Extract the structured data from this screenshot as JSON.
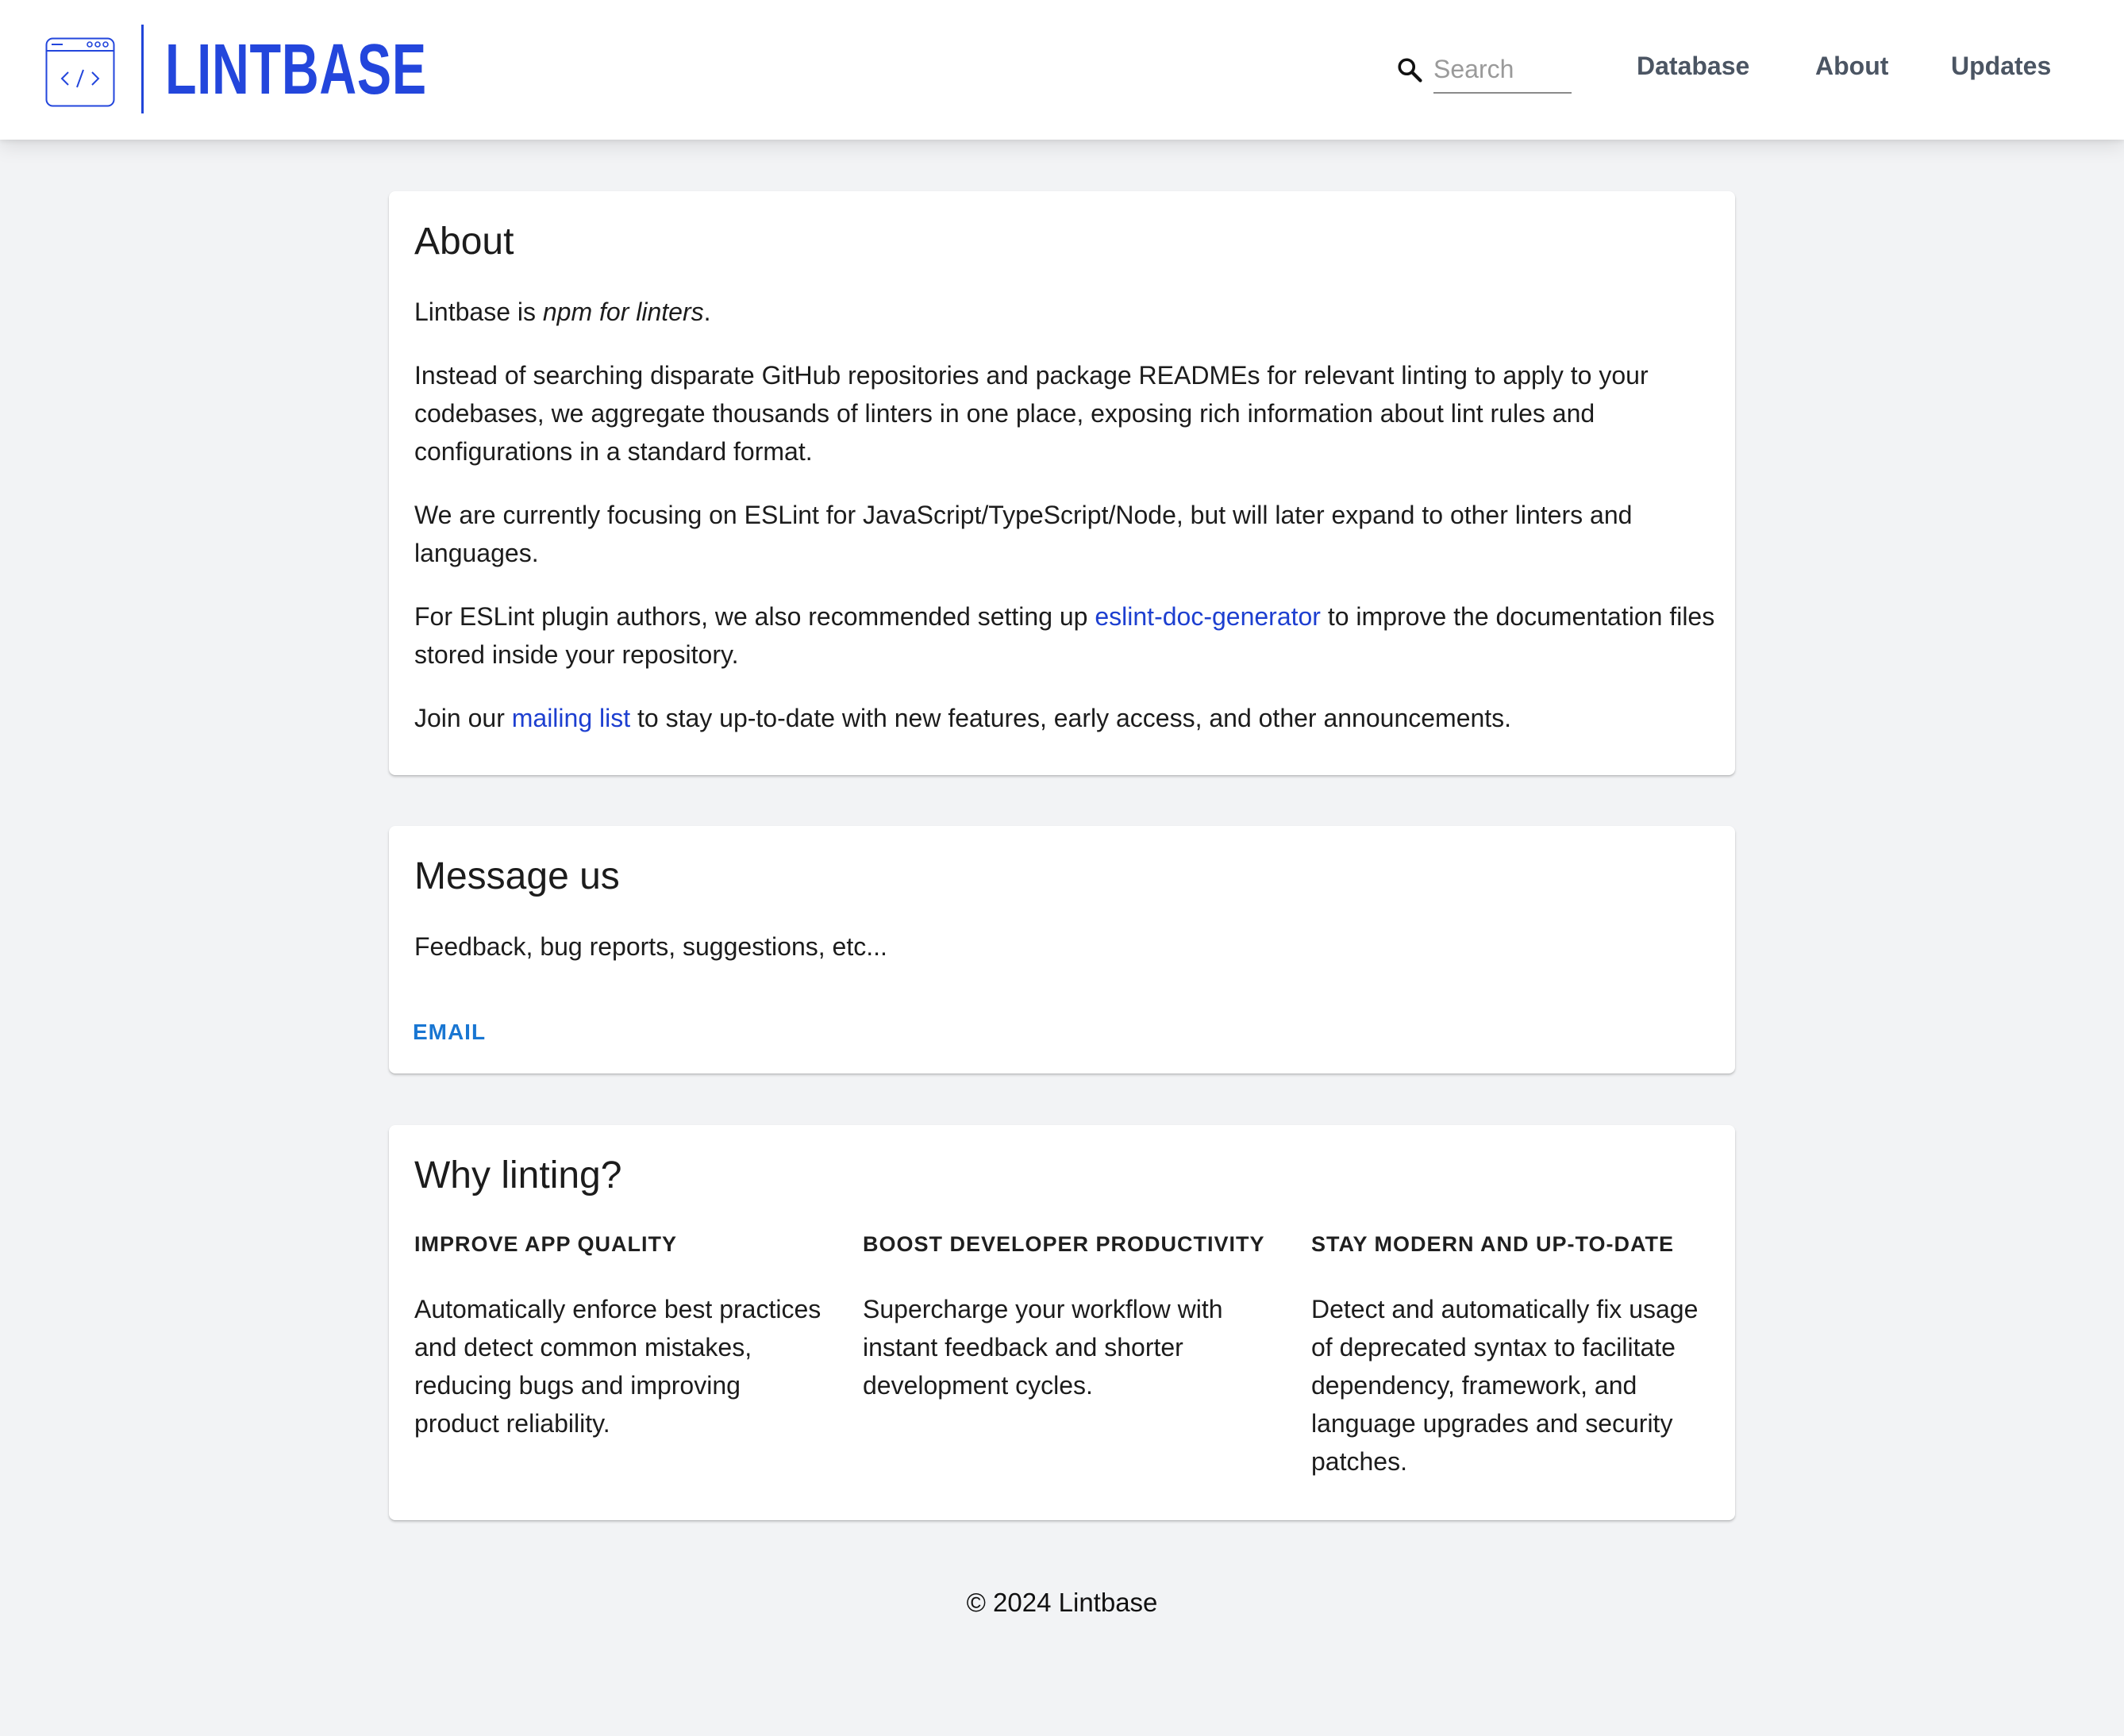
{
  "header": {
    "brand": "LINTBASE",
    "search": {
      "placeholder": "Search",
      "value": ""
    },
    "nav": {
      "database": "Database",
      "about": "About",
      "updates": "Updates"
    }
  },
  "about": {
    "title": "About",
    "p1": {
      "before": "Lintbase is ",
      "italic": "npm for linters",
      "after": "."
    },
    "p2": "Instead of searching disparate GitHub repositories and package READMEs for relevant linting to apply to your codebases, we aggregate thousands of linters in one place, exposing rich information about lint rules and configurations in a standard format.",
    "p3": "We are currently focusing on ESLint for JavaScript/TypeScript/Node, but will later expand to other linters and languages.",
    "p4": {
      "before": "For ESLint plugin authors, we also recommended setting up ",
      "link": "eslint-doc-generator",
      "after": " to improve the documentation files stored inside your repository."
    },
    "p5": {
      "before": "Join our ",
      "link": "mailing list",
      "after": " to stay up-to-date with new features, early access, and other announcements."
    }
  },
  "message": {
    "title": "Message us",
    "text": "Feedback, bug reports, suggestions, etc...",
    "email_label": "EMAIL"
  },
  "why": {
    "title": "Why linting?",
    "columns": [
      {
        "title": "IMPROVE APP QUALITY",
        "body": "Automatically enforce best practices and detect common mistakes, reducing bugs and improving product reliability."
      },
      {
        "title": "BOOST DEVELOPER PRODUCTIVITY",
        "body": "Supercharge your workflow with instant feedback and shorter development cycles."
      },
      {
        "title": "STAY MODERN AND UP-TO-DATE",
        "body": "Detect and automatically fix usage of deprecated syntax to facilitate dependency, framework, and language upgrades and security patches."
      }
    ]
  },
  "footer": {
    "copyright": "© 2024 Lintbase"
  },
  "colors": {
    "brand": "#2346dc",
    "link": "#1d3fd0",
    "button": "#1976d2",
    "background": "#f2f3f5"
  },
  "icons": {
    "logo": "code-window-icon",
    "search": "search-icon"
  }
}
